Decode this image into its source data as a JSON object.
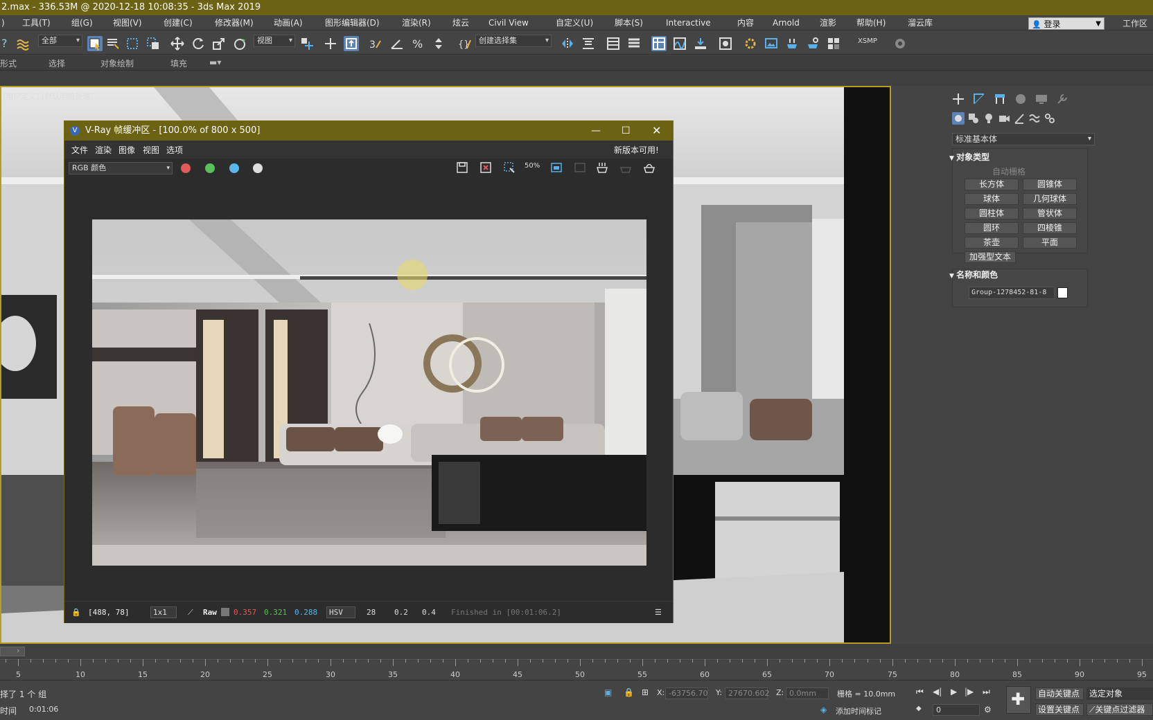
{
  "app": {
    "title": "2.max - 336.53M @ 2020-12-18 10:08:35 - 3ds Max 2019",
    "login_label": "登录",
    "workspace_label": "工作区"
  },
  "menu": {
    "items": [
      "工具(T)",
      "组(G)",
      "视图(V)",
      "创建(C)",
      "修改器(M)",
      "动画(A)",
      "图形编辑器(D)",
      "渲染(R)",
      "炫云",
      "Civil View",
      "自定义(U)",
      "脚本(S)",
      "Interactive",
      "内容",
      "Arnold",
      "渲影",
      "帮助(H)",
      "溜云库"
    ]
  },
  "toolbar": {
    "filter_value": "全部",
    "refcoord_value": "视图",
    "selection_set_placeholder": "创建选择集",
    "xsmp_label": "XSMP"
  },
  "ribbon": {
    "items": [
      "形式",
      "选择",
      "对象绘制",
      "填充"
    ]
  },
  "viewport": {
    "label": "[用户定义] [默认明暗处理]"
  },
  "vfb": {
    "title": "V-Ray 帧缓冲区 - [100.0% of 800 x 500]",
    "menu": [
      "文件",
      "渲染",
      "图像",
      "视图",
      "选项"
    ],
    "update_notice": "新版本可用!",
    "channel": "RGB 颜色",
    "status": {
      "coords": "[488, 78]",
      "ratio": "1x1",
      "raw_label": "Raw",
      "r": "0.357",
      "g": "0.321",
      "b": "0.288",
      "mode": "HSV",
      "h": "28",
      "s": "0.2",
      "v": "0.4",
      "finished": "Finished in [00:01:06.2]"
    }
  },
  "command_panel": {
    "category": "标准基本体",
    "object_type_header": "对象类型",
    "autogrid_label": "自动栅格",
    "buttons": [
      "长方体",
      "圆锥体",
      "球体",
      "几何球体",
      "圆柱体",
      "管状体",
      "圆环",
      "四棱锥",
      "茶壶",
      "平面",
      "加强型文本"
    ],
    "name_color_header": "名称和颜色",
    "object_name": "Group-1278452-81-8"
  },
  "timeline": {
    "ticks": [
      "5",
      "10",
      "15",
      "20",
      "25",
      "30",
      "35",
      "40",
      "45",
      "50",
      "55",
      "60",
      "65",
      "70",
      "75",
      "80",
      "85",
      "90",
      "95"
    ]
  },
  "status_bar": {
    "selection": "择了 1 个 组",
    "time_label": "时间",
    "time_value": "0:01:06",
    "x_value": "-63756.70",
    "y_value": "27670.602",
    "z_value": "0.0mm",
    "grid": "栅格 = 10.0mm",
    "add_time_tag": "添加时间标记",
    "auto_key": "自动关键点",
    "selected_object": "选定对象",
    "set_key": "设置关键点",
    "key_filter": "关键点过滤器",
    "frame_value": "0"
  },
  "colors": {
    "title_bar": "#6b6213",
    "viewport_border": "#b89b25",
    "active_tool": "#5b83b6"
  }
}
